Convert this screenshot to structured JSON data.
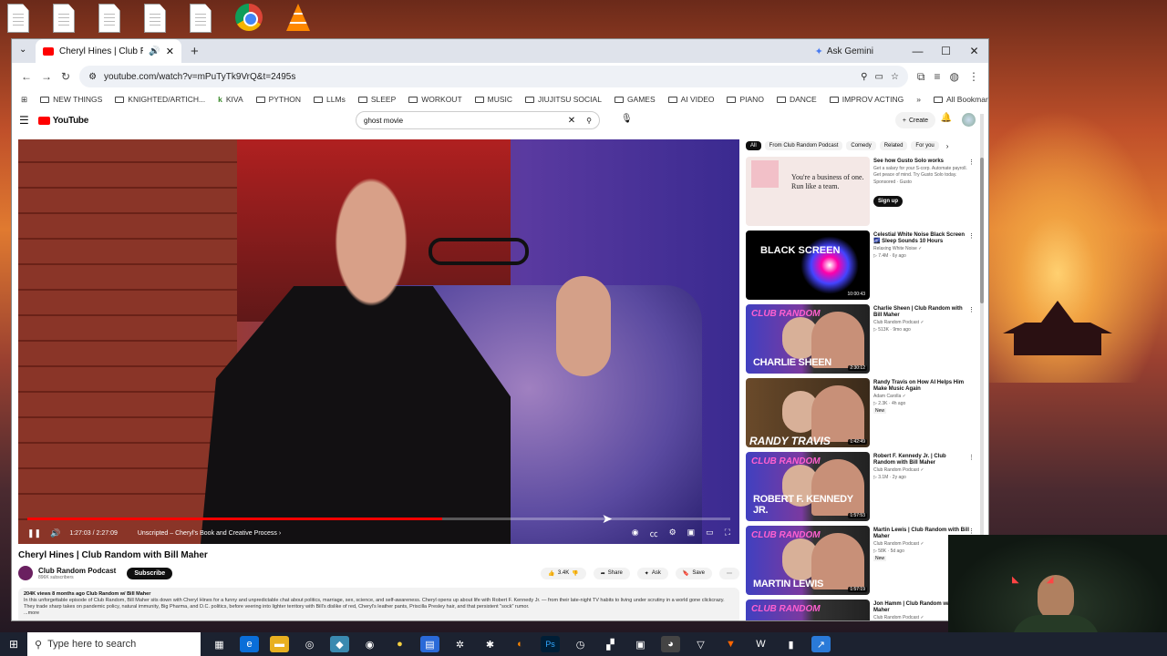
{
  "browser": {
    "tab_title": "Cheryl Hines | Club Random",
    "ask_gemini": "Ask Gemini",
    "url": "youtube.com/watch?v=mPuTyTk9VrQ&t=2495s",
    "bookmarks": [
      "NEW THINGS",
      "KNIGHTED/ARTICH...",
      "KIVA",
      "PYTHON",
      "LLMs",
      "SLEEP",
      "WORKOUT",
      "MUSIC",
      "JIUJITSU SOCIAL",
      "GAMES",
      "AI VIDEO",
      "PIANO",
      "DANCE",
      "IMPROV ACTING"
    ],
    "all_bookmarks": "All Bookmarks"
  },
  "youtube": {
    "logo": "YouTube",
    "search_value": "ghost movie",
    "create": "Create"
  },
  "player": {
    "time": "1:27:03 / 2:27:09",
    "chapter": "Unscripted – Cheryl's Book and Creative Process ›",
    "progress": 0.59
  },
  "video": {
    "title": "Cheryl Hines | Club Random with Bill Maher",
    "channel": "Club Random Podcast",
    "subscribers": "896K subscribers",
    "subscribe": "Subscribe",
    "likes": "3.4K",
    "share": "Share",
    "ask": "Ask",
    "save": "Save",
    "meta": "204K views  8 months ago  Club Random w/ Bill Maher",
    "description": "In this unforgettable episode of Club Random, Bill Maher sits down with Cheryl Hines for a funny and unpredictable chat about politics, marriage, sex, science, and self-awareness. Cheryl opens up about life with Robert F. Kennedy Jr. — from their late-night TV habits to living under scrutiny in a world gone clickcrazy. They trade sharp takes on pandemic policy, natural immunity, Big Pharma, and D.C. politics, before veering into lighter territory with Bill's dislike of red, Cheryl's leather pants, Priscilla Presley hair, and that persistent \"sock\" rumor.",
    "more": "...more"
  },
  "chips": [
    "All",
    "From Club Random Podcast",
    "Comedy",
    "Related",
    "For you"
  ],
  "ad": {
    "thumb_text": "You're a business of one. Run like a team.",
    "title": "See how Gusto Solo works",
    "desc": "Get a salary for your S-corp. Automate payroll. Get peace of mind. Try Gusto Solo today.",
    "sponsored": "Sponsored · Gusto",
    "cta": "Sign up"
  },
  "recs": [
    {
      "title": "Celestial White Noise Black Screen 🌌 Sleep Sounds 10 Hours",
      "channel": "Relaxing White Noise ✓",
      "meta": "▷ 7.4M · 6y ago",
      "duration": "10:00:43",
      "thumb": "BLACK SCREEN"
    },
    {
      "title": "Charlie Sheen | Club Random with Bill Maher",
      "channel": "Club Random Podcast ✓",
      "meta": "▷ 513K · 9mo ago",
      "duration": "2:30:12",
      "thumb": "CHARLIE SHEEN"
    },
    {
      "title": "Randy Travis on How AI Helps Him Make Music Again",
      "channel": "Adam Carolla ✓",
      "meta": "▷ 2.3K · 4h ago",
      "badge": "New",
      "duration": "1:42:49",
      "thumb": "RANDY TRAVIS"
    },
    {
      "title": "Robert F. Kennedy Jr. | Club Random with Bill Maher",
      "channel": "Club Random Podcast ✓",
      "meta": "▷ 3.1M · 2y ago",
      "duration": "1:57:53",
      "thumb": "ROBERT F. KENNEDY JR."
    },
    {
      "title": "Martin Lewis | Club Random with Bill Maher",
      "channel": "Club Random Podcast ✓",
      "meta": "▷ 58K · 5d ago",
      "badge": "New",
      "duration": "1:57:19",
      "thumb": "MARTIN LEWIS"
    },
    {
      "title": "Jon Hamm | Club Random w/ Bill Maher",
      "channel": "Club Random Podcast ✓",
      "meta": "",
      "duration": "",
      "thumb": ""
    }
  ],
  "club_random_logo": "CLUB RANDOM",
  "taskbar": {
    "search_placeholder": "Type here to search"
  }
}
